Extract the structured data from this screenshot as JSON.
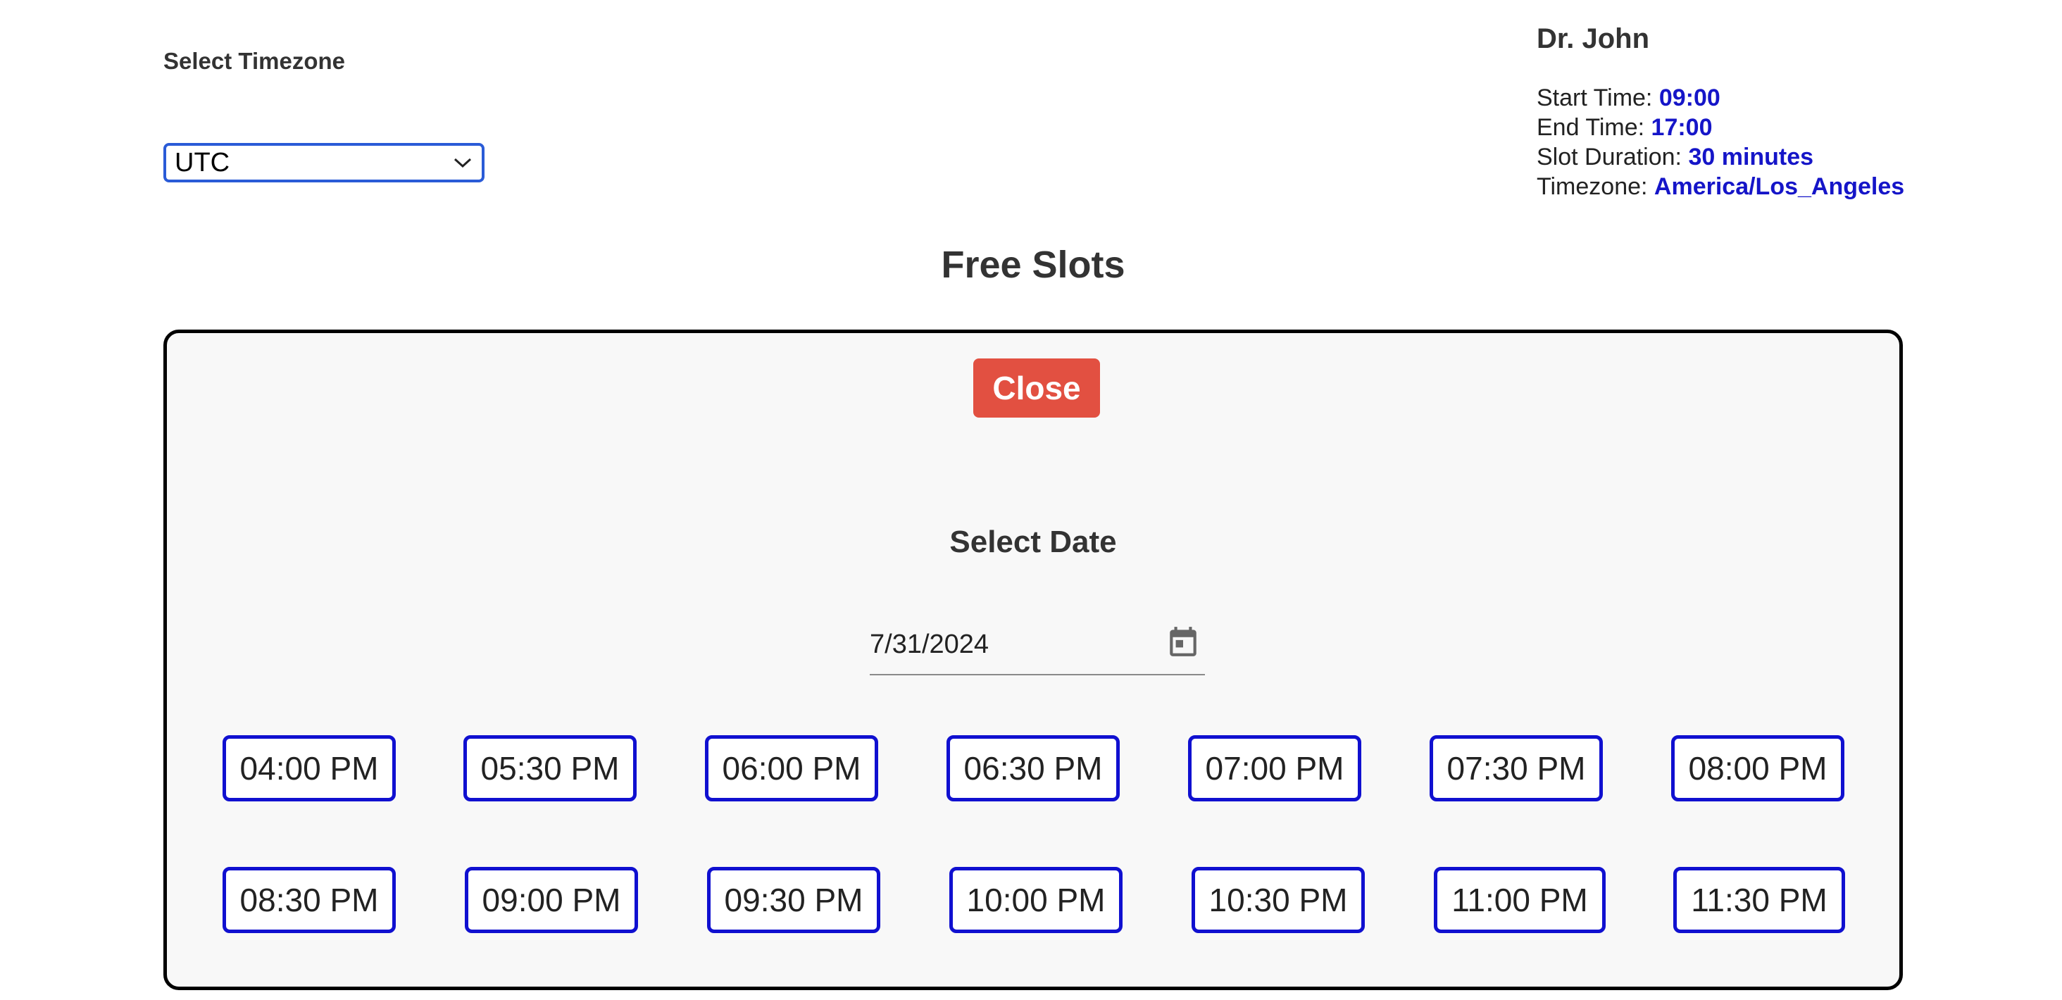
{
  "timezone": {
    "label": "Select Timezone",
    "selected": "UTC"
  },
  "doctor": {
    "name": "Dr. John",
    "start_label": "Start Time:",
    "start_value": "09:00",
    "end_label": "End Time:",
    "end_value": "17:00",
    "duration_label": "Slot Duration:",
    "duration_value": "30 minutes",
    "tz_label": "Timezone:",
    "tz_value": "America/Los_Angeles"
  },
  "heading": "Free Slots",
  "panel": {
    "close_label": "Close",
    "select_date_label": "Select Date",
    "date_value": "7/31/2024",
    "slots": [
      "04:00 PM",
      "05:30 PM",
      "06:00 PM",
      "06:30 PM",
      "07:00 PM",
      "07:30 PM",
      "08:00 PM",
      "08:30 PM",
      "09:00 PM",
      "09:30 PM",
      "10:00 PM",
      "10:30 PM",
      "11:00 PM",
      "11:30 PM"
    ]
  },
  "colors": {
    "accent_blue": "#1010d0",
    "value_blue": "#1515c8",
    "close_red": "#e25041",
    "select_border": "#2a5bd7"
  },
  "icons": {
    "select": "chevron-down-icon",
    "date": "calendar-icon"
  }
}
